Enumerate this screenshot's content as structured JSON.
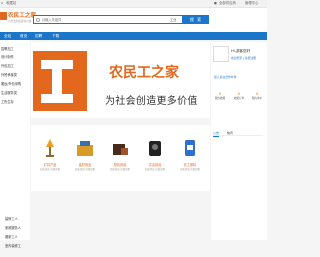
{
  "topbar": {
    "left_icon": "home-icon",
    "left_text": "收藏站",
    "right_icon": "user-icon",
    "right_text": "全部供应商",
    "right_link": "管理中心"
  },
  "header": {
    "logo_title": "农民工之家",
    "logo_subtitle": "为社会创造更多价值",
    "search_placeholder": "请输入关键词",
    "search_scope": "工业",
    "search_button": "搜 索"
  },
  "nav": {
    "items": [
      "全站",
      "首页",
      "招聘",
      "下载"
    ]
  },
  "sidebar": {
    "items": [
      "招聘加工",
      "设计制作",
      "外包加工",
      "外贸承接类",
      "搬运/外包采购",
      "生活服务类",
      "工伤生存"
    ]
  },
  "banner": {
    "title": "农民工之家",
    "slogan": "为社会创造更多价值"
  },
  "products": [
    {
      "name": "灯具产品",
      "desc": "品质优良 价格实惠"
    },
    {
      "name": "建材用品",
      "desc": "品质优良 价格实惠"
    },
    {
      "name": "厨具用品",
      "desc": "品质优良 价格实惠"
    },
    {
      "name": "清洁用品",
      "desc": "品质优良 价格实惠"
    },
    {
      "name": "化工原料",
      "desc": "品质优良 价格实惠"
    }
  ],
  "user": {
    "name": "Hi,游客您好",
    "action": "欢迎登录 | 免费注册",
    "link": "加入商业合作伙伴",
    "stats": [
      {
        "value": "0",
        "label": "我的收藏"
      },
      {
        "value": "0",
        "label": "收藏订单"
      },
      {
        "value": "0",
        "label": "我的询价"
      }
    ],
    "tabs": [
      "公告",
      "快讯"
    ]
  },
  "bottom_categories": [
    "装修工人",
    "家政服务人",
    "搬家工人",
    "室内装修工"
  ]
}
